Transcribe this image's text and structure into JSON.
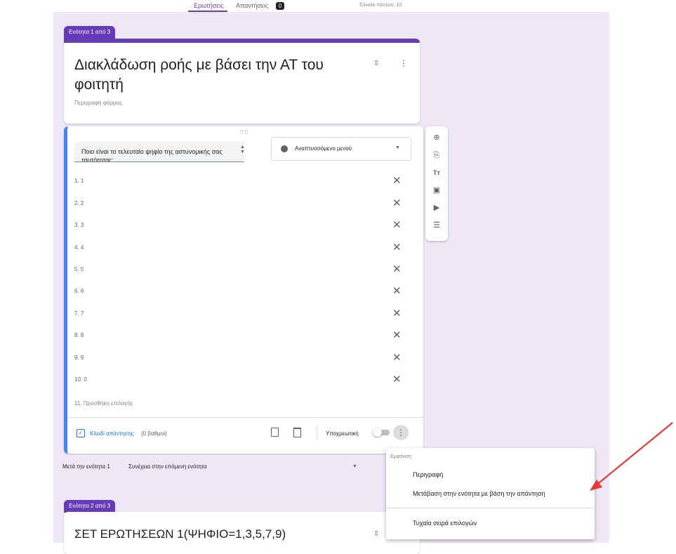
{
  "header": {
    "tab_questions": "Ερωτήσεις",
    "tab_responses": "Απαντήσεις",
    "responses_count": "0",
    "total_points": "Σύνολο πόντων: 10"
  },
  "section1": {
    "tab_label": "Ενότητα 1 από 3",
    "title": "Διακλάδωση ροής με βάσει την ΑΤ του φοιτητή",
    "description": "Περιγραφή φόρμας"
  },
  "question": {
    "drag": "⠿⠿",
    "text": "Ποιο είναι το τελευταίο ψηφίο της αστυνομικής σας ταυτότητας;",
    "type_label": "Αναπτυσσόμενο μενού",
    "options": [
      {
        "label": "1. 1"
      },
      {
        "label": "2. 2"
      },
      {
        "label": "3. 3"
      },
      {
        "label": "4. 4"
      },
      {
        "label": "5. 5"
      },
      {
        "label": "6. 6"
      },
      {
        "label": "7. 7"
      },
      {
        "label": "8. 8"
      },
      {
        "label": "9. 9"
      },
      {
        "label": "10. 0"
      }
    ],
    "add_option": "11. Προσθήκη επιλογής",
    "answer_key": "Κλειδί απάντησης",
    "points": "(0 βαθμοί)",
    "required": "Υποχρεωτική"
  },
  "after_section": {
    "label": "Μετά την ενότητα 1",
    "value": "Συνέχεια στην επόμενη ενότητα"
  },
  "section2": {
    "tab_label": "Ενότητα 2 από 3",
    "title": "ΣΕΤ ΕΡΩΤΗΣΕΩΝ 1(ΨΗΦΙΟ=1,3,5,7,9)"
  },
  "menu": {
    "header": "Εμφάνιση",
    "items": [
      {
        "label": "Περιγραφή"
      },
      {
        "label": "Μετάβαση στην ενότητα με βάση την απάντηση"
      },
      {
        "label": "Τυχαία σειρά επιλογών"
      }
    ]
  },
  "colors": {
    "accent": "#673ab7",
    "focus": "#4285f4",
    "annotation_arrow": "#e53935"
  },
  "icons": [
    "collapse-icon",
    "more-vert-icon",
    "add-circle-icon",
    "import-icon",
    "title-icon",
    "image-icon",
    "video-icon",
    "section-icon",
    "close-icon",
    "checkbox-icon",
    "copy-icon",
    "trash-icon"
  ]
}
